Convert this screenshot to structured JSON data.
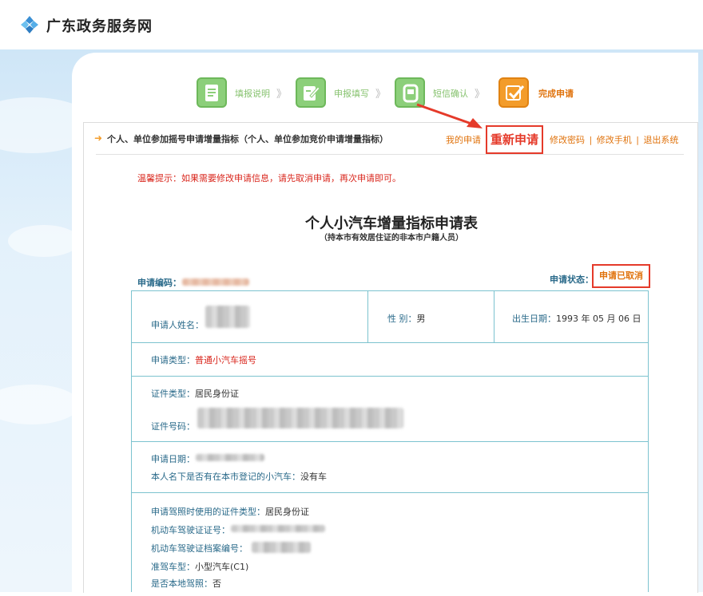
{
  "header": {
    "site_title": "广东政务服务网"
  },
  "steps": [
    {
      "label": "填报说明"
    },
    {
      "label": "申报填写"
    },
    {
      "label": "短信确认"
    },
    {
      "label": "完成申请"
    }
  ],
  "step_arrow": "》",
  "nav": {
    "section_title": "个人、单位参加摇号申请增量指标（个人、单位参加竞价申请增量指标）",
    "my_application": "我的申请",
    "reapply": "重新申请",
    "change_password": "修改密码",
    "change_phone": "修改手机",
    "logout": "退出系统",
    "separator": "|"
  },
  "tip": "温馨提示：如果需要修改申请信息，请先取消申请，再次申请即可。",
  "form": {
    "title": "个人小汽车增量指标申请表",
    "subtitle": "（持本市有效居住证的非本市户籍人员）",
    "app_no_label": "申请编码：",
    "status_label": "申请状态：",
    "status_value": "申请已取消",
    "applicant_name_label": "申请人姓名：",
    "gender_label": "性 别：",
    "gender_value": "男",
    "birth_label": "出生日期：",
    "birth_value": "1993 年 05 月 06 日",
    "app_type_label": "申请类型：",
    "app_type_value": "普通小汽车摇号",
    "id_type_label": "证件类型：",
    "id_type_value": "居民身份证",
    "id_no_label": "证件号码：",
    "apply_date_label": "申请日期：",
    "has_car_label": "本人名下是否有在本市登记的小汽车：",
    "has_car_value": "没有车",
    "license_id_type_label": "申请驾照时使用的证件类型：",
    "license_id_type_value": "居民身份证",
    "license_no_label": "机动车驾驶证证号：",
    "license_file_label": "机动车驾驶证档案编号：",
    "vehicle_class_label": "准驾车型：",
    "vehicle_class_value": "小型汽车(C1)",
    "local_license_label": "是否本地驾照：",
    "local_license_value": "否"
  }
}
